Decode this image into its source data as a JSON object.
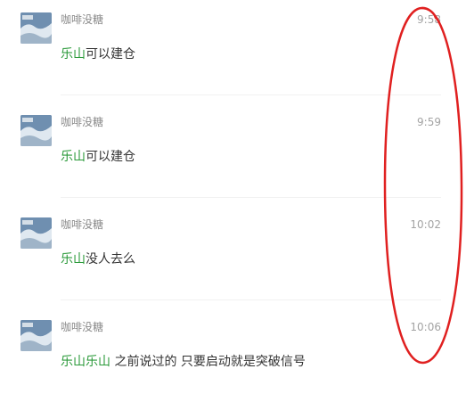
{
  "messages": [
    {
      "sender": "咖啡没糖",
      "time": "9:58",
      "mention": "乐山",
      "text": "可以建仓"
    },
    {
      "sender": "咖啡没糖",
      "time": "9:59",
      "mention": "乐山",
      "text": "可以建仓"
    },
    {
      "sender": "咖啡没糖",
      "time": "10:02",
      "mention": "乐山",
      "text": "没人去么"
    },
    {
      "sender": "咖啡没糖",
      "time": "10:06",
      "mention": "乐山乐山",
      "text": " 之前说过的 只要启动就是突破信号"
    }
  ],
  "colors": {
    "mention": "#2b9a3a",
    "annotation": "#e02020"
  }
}
